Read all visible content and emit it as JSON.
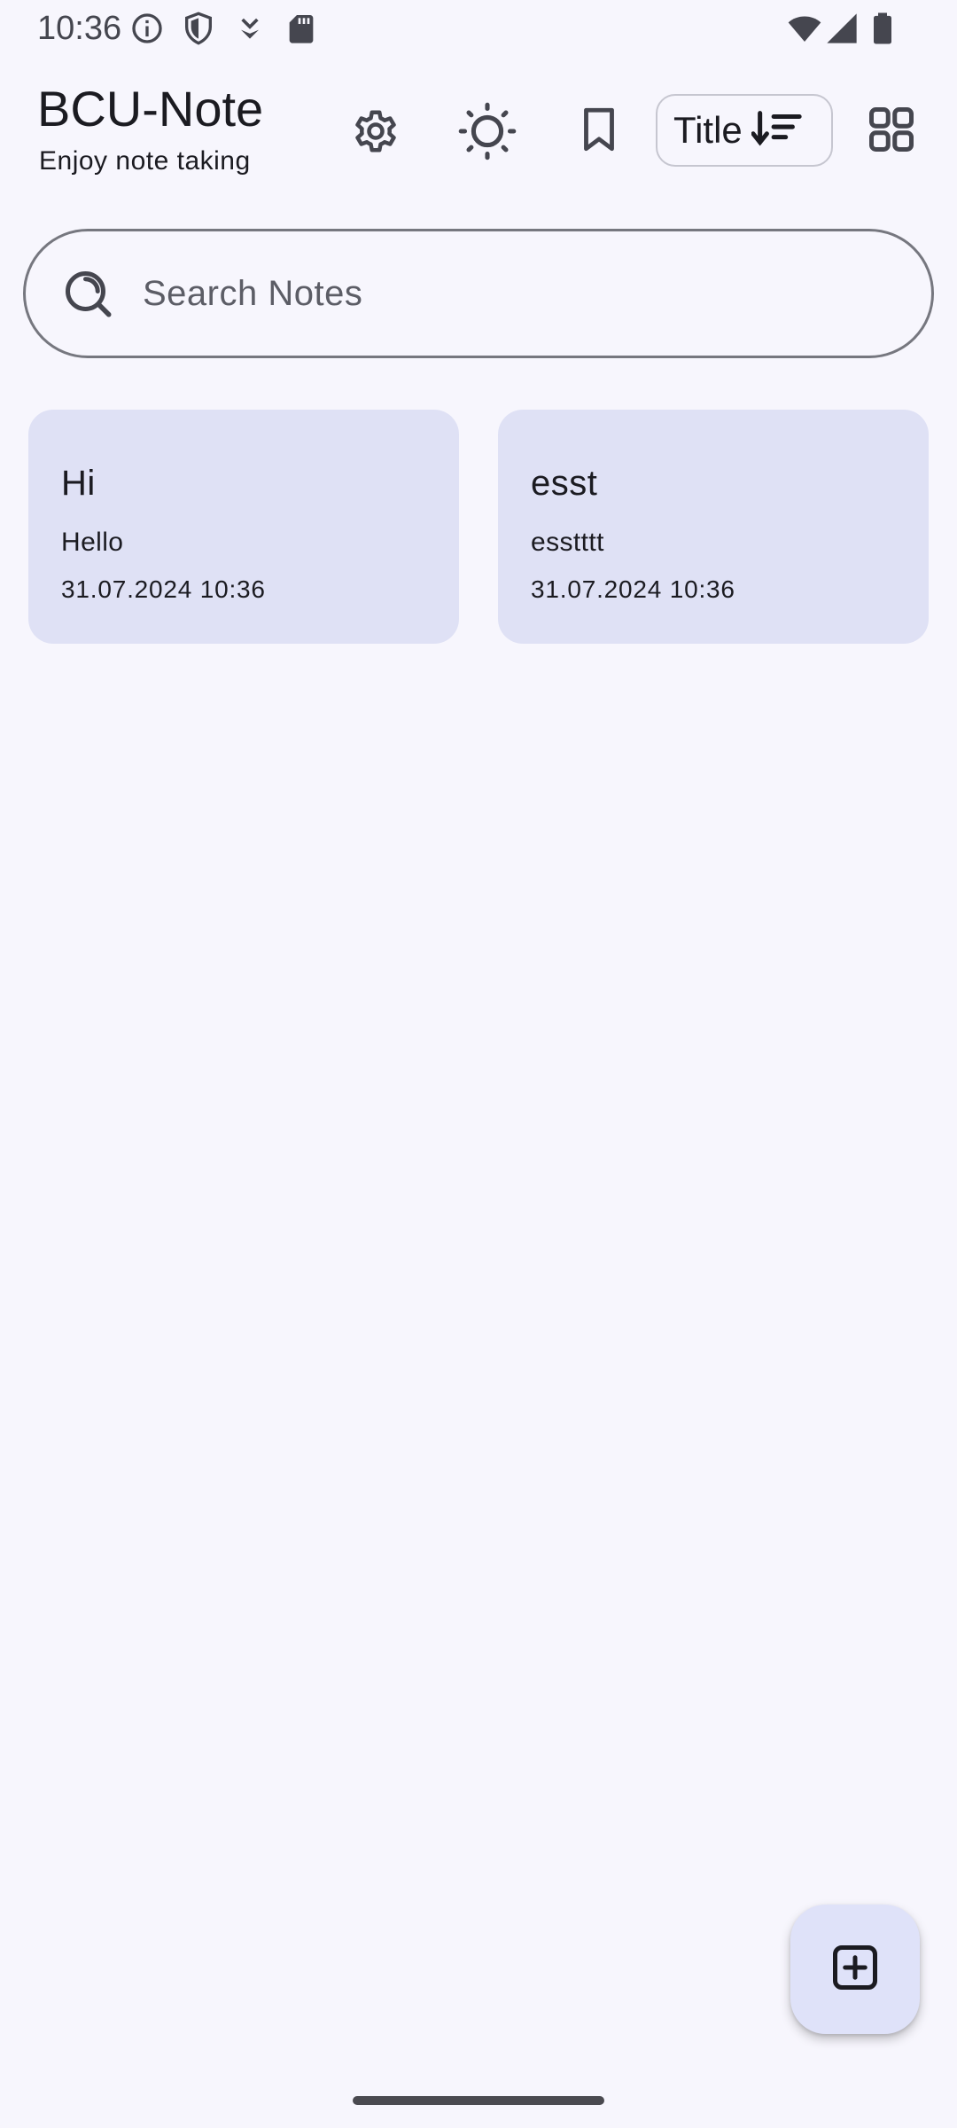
{
  "status_bar": {
    "time": "10:36",
    "icons": [
      "info-icon",
      "shield-icon",
      "download-icon",
      "sd-card-icon",
      "wifi-icon",
      "signal-icon",
      "battery-icon"
    ]
  },
  "header": {
    "title": "BCU-Note",
    "subtitle": "Enjoy note taking",
    "actions": [
      "settings-icon",
      "theme-sun-icon",
      "bookmark-icon"
    ],
    "sort": {
      "label": "Title",
      "icon": "sort-descending-icon"
    },
    "layout_icon": "grid-view-icon"
  },
  "search": {
    "placeholder": "Search Notes",
    "value": ""
  },
  "notes": [
    {
      "title": "Hi",
      "body": "Hello",
      "date": "31.07.2024 10:36"
    },
    {
      "title": "esst",
      "body": "esstttt",
      "date": "31.07.2024 10:36"
    }
  ],
  "fab": {
    "icon": "add-note-icon"
  },
  "colors": {
    "background": "#f7f6fd",
    "card": "#dfe1f5",
    "fab": "#dfe2f9",
    "text": "#1b1b21"
  }
}
